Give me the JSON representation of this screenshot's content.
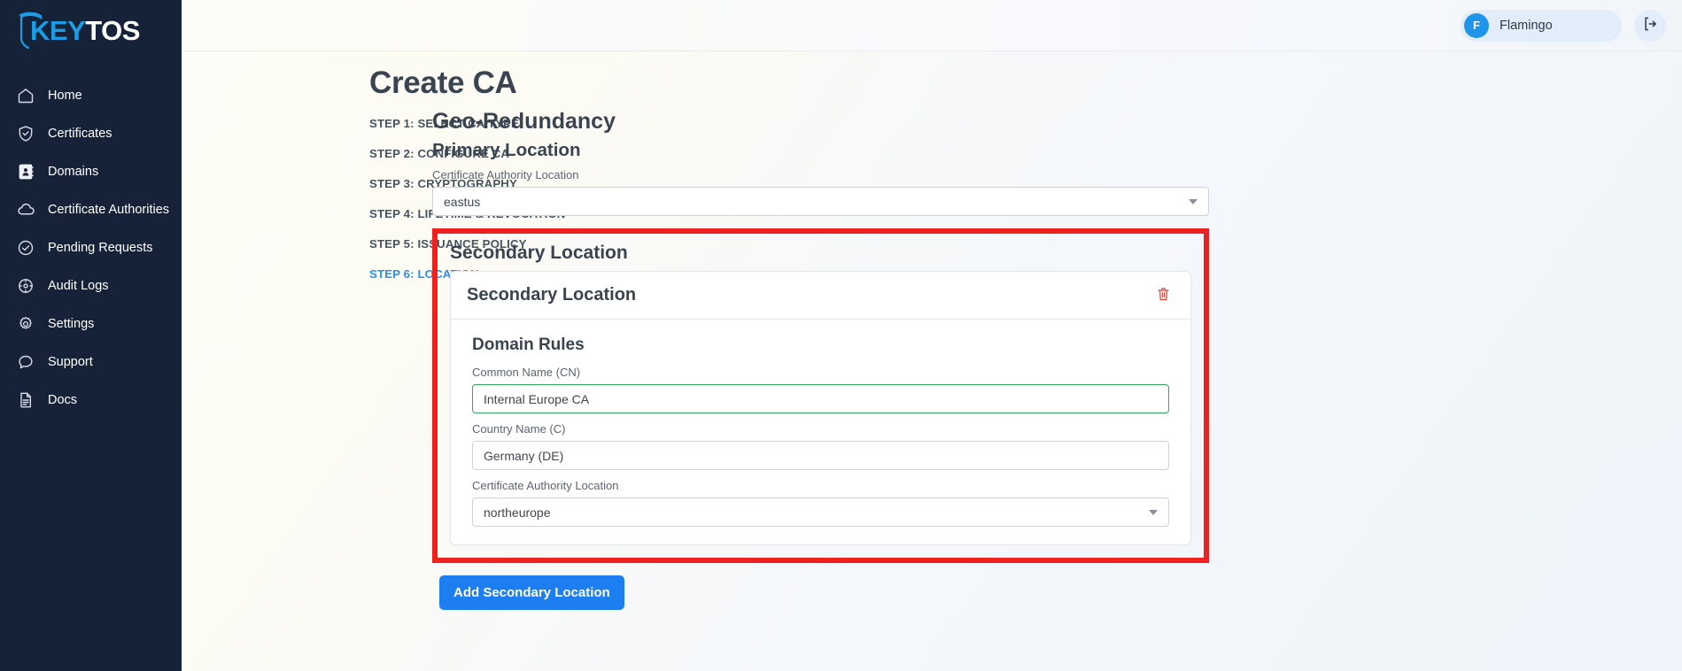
{
  "brand": {
    "logo_key": "KEY",
    "logo_tos": "TOS"
  },
  "sidebar": {
    "items": [
      {
        "label": "Home",
        "icon": "home-icon"
      },
      {
        "label": "Certificates",
        "icon": "shield-check-icon"
      },
      {
        "label": "Domains",
        "icon": "address-book-icon"
      },
      {
        "label": "Certificate Authorities",
        "icon": "cloud-icon"
      },
      {
        "label": "Pending Requests",
        "icon": "check-circle-icon"
      },
      {
        "label": "Audit Logs",
        "icon": "clock-icon"
      },
      {
        "label": "Settings",
        "icon": "gear-icon"
      },
      {
        "label": "Support",
        "icon": "chat-bubble-icon"
      },
      {
        "label": "Docs",
        "icon": "document-icon"
      }
    ]
  },
  "topbar": {
    "user_initial": "F",
    "user_name": "Flamingo",
    "logout_icon": "logout-icon"
  },
  "page": {
    "title": "Create CA"
  },
  "steps": [
    {
      "label": "STEP 1: SELECT CA TYPE",
      "active": false
    },
    {
      "label": "STEP 2: CONFIGURE CA",
      "active": false
    },
    {
      "label": "STEP 3: CRYPTOGRAPHY",
      "active": false
    },
    {
      "label": "STEP 4: LIFETIME & REVOCATION",
      "active": false
    },
    {
      "label": "STEP 5: ISSUANCE POLICY",
      "active": false
    },
    {
      "label": "STEP 6: LOCATION",
      "active": true
    }
  ],
  "form": {
    "geo_redundancy_heading": "Geo-Redundancy",
    "primary_location_heading": "Primary Location",
    "primary_location_label": "Certificate Authority Location",
    "primary_location_value": "eastus",
    "secondary_section_heading": "Secondary Location",
    "secondary_card_title": "Secondary Location",
    "delete_icon": "trash-icon",
    "domain_rules_heading": "Domain Rules",
    "common_name_label": "Common Name (CN)",
    "common_name_value": "Internal Europe CA",
    "country_name_label": "Country Name (C)",
    "country_name_value": "Germany (DE)",
    "secondary_location_label": "Certificate Authority Location",
    "secondary_location_value": "northeurope",
    "add_secondary_button": "Add Secondary Location"
  },
  "colors": {
    "sidebar_bg": "#152238",
    "logo_blue": "#1b9ce3",
    "accent_blue": "#1d7ef2",
    "active_step": "#2b8ef0",
    "highlight_red": "#ee2020",
    "valid_green": "#2faa5c",
    "trash_red": "#e8453c",
    "page_bg": "#fdfcf6"
  }
}
